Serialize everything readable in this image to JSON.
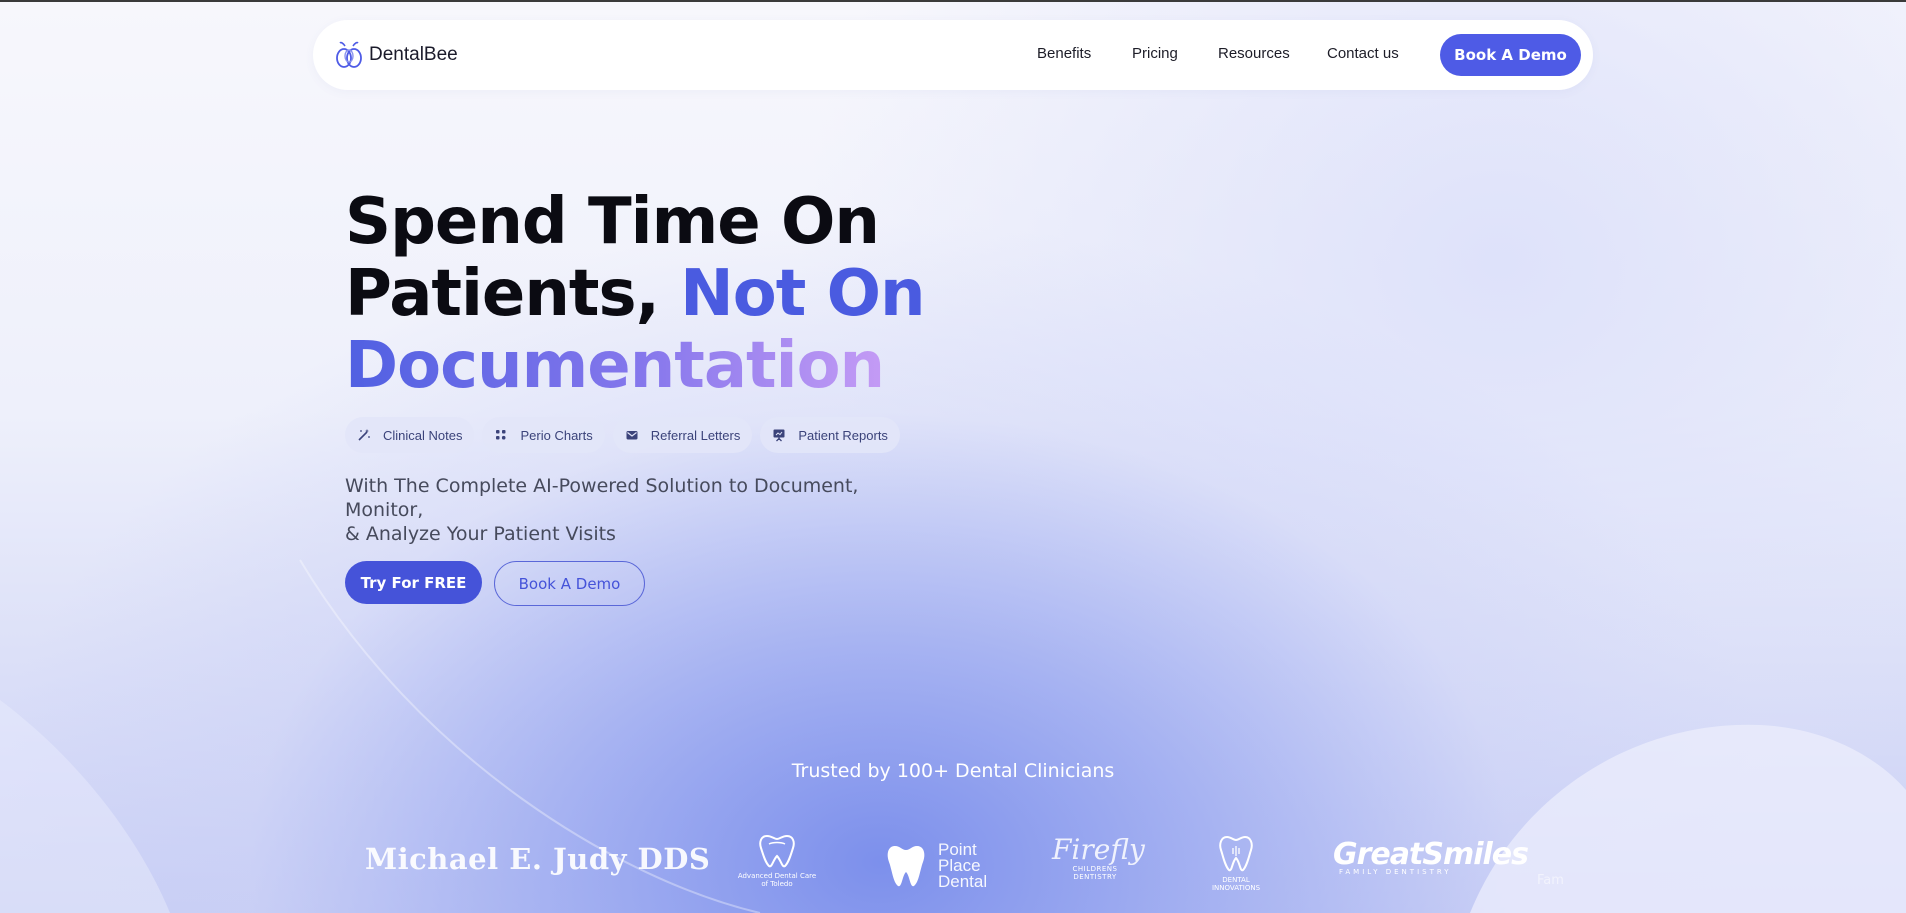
{
  "nav": {
    "brand": "DentalBee",
    "links": [
      "Benefits",
      "Pricing",
      "Resources",
      "Contact us"
    ],
    "cta": "Book A Demo"
  },
  "hero": {
    "line1": "Spend Time On",
    "line2a": "Patients, ",
    "line2b": "Not On",
    "line3": "Documentation",
    "chips": [
      {
        "label": "Clinical Notes",
        "icon": "magic-wand-icon"
      },
      {
        "label": "Perio Charts",
        "icon": "grid-dots-icon"
      },
      {
        "label": "Referral Letters",
        "icon": "envelope-icon"
      },
      {
        "label": "Patient Reports",
        "icon": "presentation-icon"
      }
    ],
    "subtitle_line1": "With The Complete AI-Powered Solution to Document, Monitor,",
    "subtitle_line2": "& Analyze Your Patient Visits",
    "primary_cta": "Try For FREE",
    "secondary_cta": "Book A Demo"
  },
  "trusted": {
    "heading": "Trusted by 100+ Dental Clinicians",
    "logos": {
      "judy": "Michael E. Judy DDS",
      "adc_line1": "Advanced Dental Care",
      "adc_line2": "of Toledo",
      "ppd_line1": "Point",
      "ppd_line2": "Place",
      "ppd_line3": "Dental",
      "firefly_name": "Firefly",
      "firefly_sub": "CHILDRENS DENTISTRY",
      "dinn_line1": "DENTAL",
      "dinn_line2": "INNOVATIONS",
      "gsm_name": "GreatSmiles",
      "gsm_sub": "FAMILY DENTISTRY",
      "faded": "Fam"
    }
  },
  "colors": {
    "accent": "#4e5be6",
    "accent_dark": "#4553d9",
    "gradient_end": "#c49bf5"
  }
}
